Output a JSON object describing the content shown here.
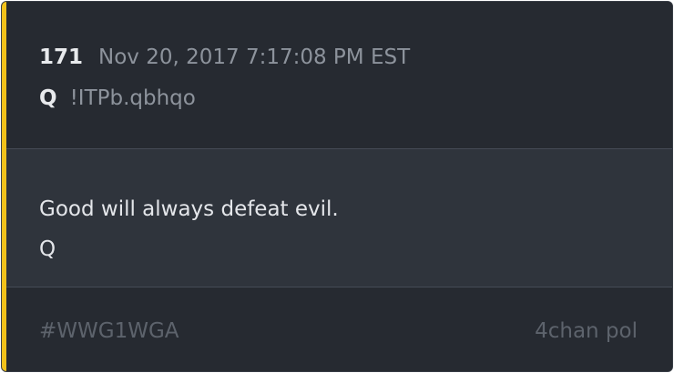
{
  "post": {
    "number": "171",
    "timestamp": "Nov 20, 2017 7:17:08 PM EST",
    "author": "Q",
    "tripcode": "!ITPb.qbhqo",
    "message_lines": [
      "Good will always defeat evil.",
      "Q"
    ]
  },
  "footer": {
    "hashtag": "#WWG1WGA",
    "source": "4chan pol"
  },
  "colors": {
    "accent": "#f2c21a",
    "card_background": "#262a31",
    "body_background": "#2f343c"
  }
}
